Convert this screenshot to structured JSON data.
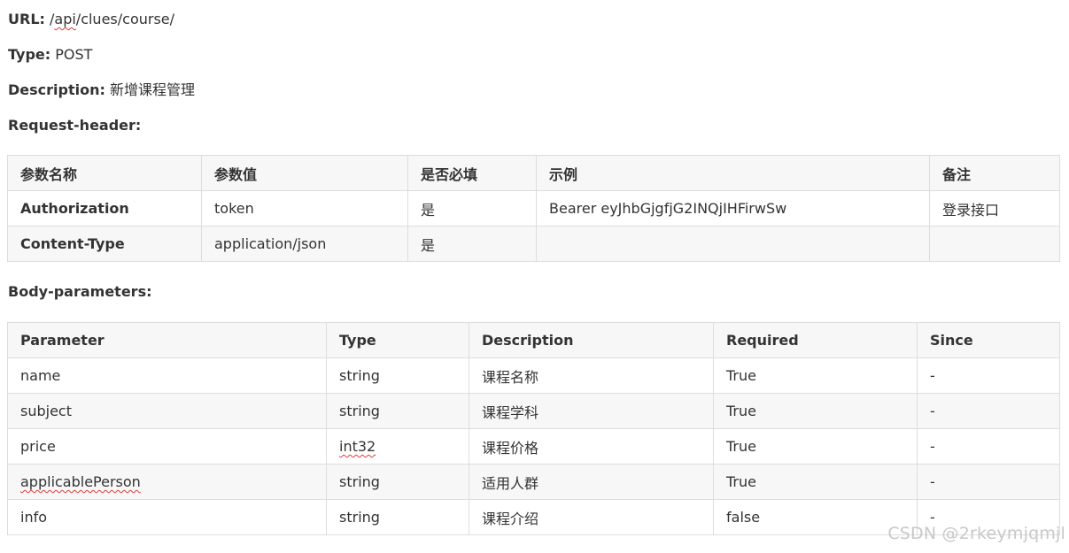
{
  "doc": {
    "url_label": "URL:",
    "url_value_prefix": "/",
    "url_value_spell": "api",
    "url_value_suffix": "/clues/course/",
    "type_label": "Type:",
    "type_value": "POST",
    "description_label": "Description:",
    "description_value": "新增课程管理",
    "request_header_label": "Request-header:",
    "body_parameters_label": "Body-parameters:"
  },
  "header_table": {
    "columns": [
      "参数名称",
      "参数值",
      "是否必填",
      "示例",
      "备注"
    ],
    "rows": [
      [
        "Authorization",
        "token",
        "是",
        "Bearer eyJhbGjgfjG2INQjIHFirwSw",
        "登录接口"
      ],
      [
        "Content-Type",
        "application/json",
        "是",
        "",
        ""
      ]
    ]
  },
  "body_table": {
    "columns": [
      "Parameter",
      "Type",
      "Description",
      "Required",
      "Since"
    ],
    "rows": [
      [
        "name",
        "string",
        "课程名称",
        "True",
        "-"
      ],
      [
        "subject",
        "string",
        "课程学科",
        "True",
        "-"
      ],
      [
        "price",
        "int32",
        "课程价格",
        "True",
        "-"
      ],
      [
        "applicablePerson",
        "string",
        "适用人群",
        "True",
        "-"
      ],
      [
        "info",
        "string",
        "课程介绍",
        "false",
        "-"
      ]
    ]
  },
  "watermark": "CSDN @2rkeymjqmjl"
}
